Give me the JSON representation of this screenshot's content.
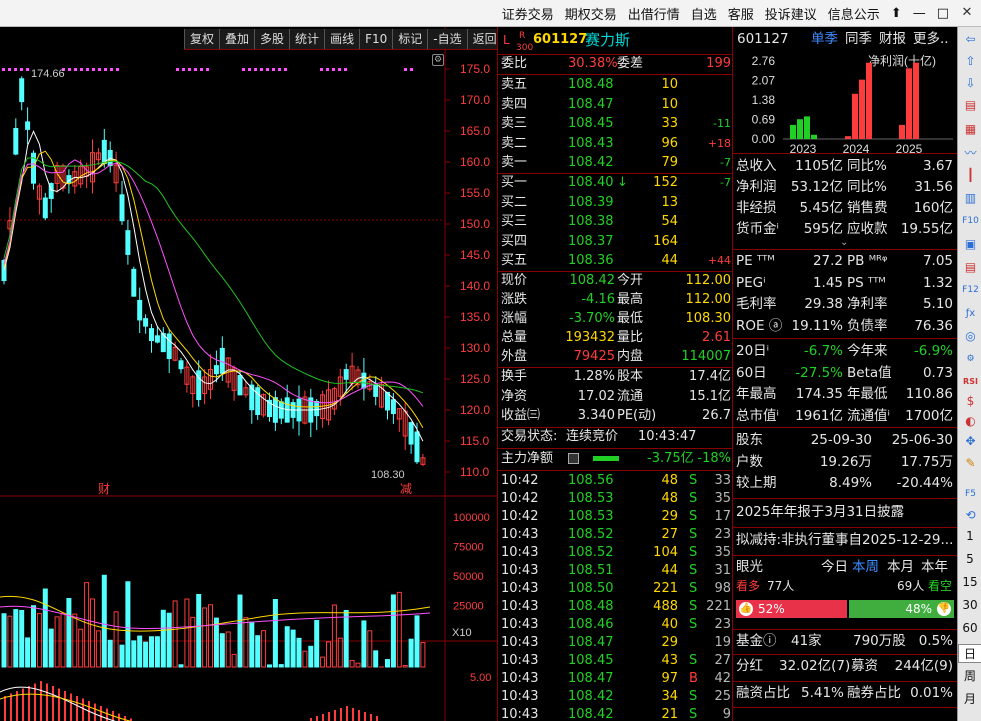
{
  "menu": [
    "证券交易",
    "期权交易",
    "出借行情",
    "自选",
    "客服",
    "投诉建议",
    "信息公示"
  ],
  "window_buttons": {
    "pin": "pin-icon",
    "min": "—",
    "max": "□",
    "close": "✕"
  },
  "chart_toolbar": [
    "复权",
    "叠加",
    "多股",
    "统计",
    "画线",
    "F10",
    "标记",
    "-自选",
    "返回"
  ],
  "price_axis": [
    "175.0",
    "170.0",
    "165.0",
    "160.0",
    "155.0",
    "150.0",
    "145.0",
    "140.0",
    "135.0",
    "130.0",
    "125.0",
    "120.0",
    "115.0",
    "110.0"
  ],
  "high_label": "174.66",
  "low_label": "108.30",
  "markers": {
    "cai": "财",
    "jian": "减"
  },
  "volume_axis": [
    "100000",
    "75000",
    "50000",
    "25000"
  ],
  "volume_unit": "X10",
  "macd_axis": [
    "5.00"
  ],
  "stock": {
    "prefix": "L",
    "tag": "R",
    "index": "300",
    "code": "601127",
    "name": "赛力斯"
  },
  "weibi": {
    "label1": "委比",
    "v1": "30.38%",
    "label2": "委差",
    "v2": "199"
  },
  "asks": [
    {
      "label": "卖五",
      "price": "108.48",
      "vol": "10",
      "chg": ""
    },
    {
      "label": "卖四",
      "price": "108.47",
      "vol": "10",
      "chg": ""
    },
    {
      "label": "卖三",
      "price": "108.45",
      "vol": "33",
      "chg": "-11"
    },
    {
      "label": "卖二",
      "price": "108.43",
      "vol": "96",
      "chg": "+18"
    },
    {
      "label": "卖一",
      "price": "108.42",
      "vol": "79",
      "chg": "-7"
    }
  ],
  "bids": [
    {
      "label": "买一",
      "price": "108.40",
      "vol": "152",
      "chg": "-7",
      "arrow": "↓"
    },
    {
      "label": "买二",
      "price": "108.39",
      "vol": "13",
      "chg": ""
    },
    {
      "label": "买三",
      "price": "108.38",
      "vol": "54",
      "chg": ""
    },
    {
      "label": "买四",
      "price": "108.37",
      "vol": "164",
      "chg": ""
    },
    {
      "label": "买五",
      "price": "108.36",
      "vol": "44",
      "chg": "+44"
    }
  ],
  "stats": [
    {
      "l1": "现价",
      "v1": "108.42",
      "c1": "grn",
      "l2": "今开",
      "v2": "112.00",
      "c2": "yel"
    },
    {
      "l1": "涨跌",
      "v1": "-4.16",
      "c1": "grn",
      "l2": "最高",
      "v2": "112.00",
      "c2": "yel"
    },
    {
      "l1": "涨幅",
      "v1": "-3.70%",
      "c1": "grn",
      "l2": "最低",
      "v2": "108.30",
      "c2": "yel"
    },
    {
      "l1": "总量",
      "v1": "193432",
      "c1": "yel",
      "l2": "量比",
      "v2": "2.61",
      "c2": "red"
    },
    {
      "l1": "外盘",
      "v1": "79425",
      "c1": "red",
      "l2": "内盘",
      "v2": "114007",
      "c2": "grn"
    }
  ],
  "stats2": [
    {
      "l1": "换手",
      "v1": "1.28%",
      "l2": "股本",
      "v2": "17.4亿"
    },
    {
      "l1": "净资",
      "v1": "17.02",
      "l2": "流通",
      "v2": "15.1亿"
    },
    {
      "l1": "收益㈢",
      "v1": "3.340",
      "l2": "PE(动)",
      "v2": "26.7"
    }
  ],
  "trade_state": {
    "label": "交易状态:",
    "value": "连续竞价",
    "time": "10:43:47"
  },
  "main_flow": {
    "label": "主力净额",
    "value": "-3.75亿",
    "pct": "-18%"
  },
  "ticks": [
    [
      "10:42",
      "108.56",
      "48",
      "S",
      "33"
    ],
    [
      "10:42",
      "108.53",
      "48",
      "S",
      "35"
    ],
    [
      "10:42",
      "108.53",
      "29",
      "S",
      "17"
    ],
    [
      "10:43",
      "108.52",
      "27",
      "S",
      "23"
    ],
    [
      "10:43",
      "108.52",
      "104",
      "S",
      "35"
    ],
    [
      "10:43",
      "108.51",
      "44",
      "S",
      "31"
    ],
    [
      "10:43",
      "108.50",
      "221",
      "S",
      "98"
    ],
    [
      "10:43",
      "108.48",
      "488",
      "S",
      "221"
    ],
    [
      "10:43",
      "108.46",
      "40",
      "S",
      "23"
    ],
    [
      "10:43",
      "108.47",
      "29",
      "",
      "19"
    ],
    [
      "10:43",
      "108.45",
      "43",
      "S",
      "27"
    ],
    [
      "10:43",
      "108.47",
      "97",
      "B",
      "42"
    ],
    [
      "10:43",
      "108.42",
      "34",
      "S",
      "25"
    ],
    [
      "10:43",
      "108.42",
      "21",
      "S",
      "9"
    ]
  ],
  "info": {
    "code": "601127",
    "tabs": [
      "单季",
      "同季",
      "财报",
      "更多.."
    ],
    "mini_title": "净利润(十亿)",
    "mini_y": [
      "2.76",
      "2.07",
      "1.38",
      "0.69",
      "0.00"
    ],
    "mini_x": [
      "2023",
      "2024",
      "2025"
    ],
    "fin": [
      {
        "l1": "总收入",
        "v1": "1105亿",
        "l2": "同比%",
        "v2": "3.67"
      },
      {
        "l1": "净利润",
        "v1": "53.12亿",
        "l2": "同比%",
        "v2": "31.56"
      },
      {
        "l1": "非经损",
        "v1": "5.45亿",
        "l2": "销售费",
        "v2": "160亿"
      },
      {
        "l1": "货币金ⁱ",
        "v1": "595亿",
        "l2": "应收款",
        "v2": "19.55亿"
      }
    ],
    "val": [
      {
        "l1": "PE ᵀᵀᴹ",
        "v1": "27.2",
        "l2": "PB ᴹᴿᵠ",
        "v2": "7.05"
      },
      {
        "l1": "PEGⁱ",
        "v1": "1.45",
        "l2": "PS ᵀᵀᴹ",
        "v2": "1.32"
      },
      {
        "l1": "毛利率",
        "v1": "29.38",
        "l2": "净利率",
        "v2": "5.10"
      },
      {
        "l1": "ROE ⓐ",
        "v1": "19.11%",
        "l2": "负债率",
        "v2": "76.36"
      }
    ],
    "perf": [
      {
        "l1": "20日ⁱ",
        "v1": "-6.7%",
        "l2": "今年来",
        "v2": "-6.9%",
        "c": "grn"
      },
      {
        "l1": "60日",
        "v1": "-27.5%",
        "l2": "Beta值",
        "v2": "0.73",
        "c": "grn"
      },
      {
        "l1": "年最高",
        "v1": "174.35",
        "l2": "年最低",
        "v2": "110.86",
        "c": "wht"
      },
      {
        "l1": "总市值ⁱ",
        "v1": "1961亿",
        "l2": "流通值ⁱ",
        "v2": "1700亿",
        "c": "wht"
      }
    ],
    "holders": [
      {
        "l": "股东",
        "a": "25-09-30",
        "b": "25-06-30"
      },
      {
        "l": "户数",
        "a": "19.26万",
        "b": "17.75万"
      },
      {
        "l": "较上期",
        "a": "8.49%",
        "b": "-20.44%"
      }
    ],
    "notice1": "2025年年报于3月31日披露",
    "notice2": "拟减持:非执行董事自2025-12-29...",
    "eye": {
      "label": "眼光",
      "t1": "今日",
      "t2": "本周",
      "t3": "本月",
      "t4": "本年",
      "bear": "看多",
      "bear_n": "77人",
      "bull_n": "69人",
      "bull": "看空",
      "p1": "52%",
      "p2": "48%"
    },
    "fund": {
      "l": "基金ⓘ",
      "a": "41家",
      "b": "790万股",
      "c": "0.5%"
    },
    "div": {
      "l": "分红",
      "a": "32.02亿(7)",
      "b": "募资",
      "c": "244亿(9)"
    },
    "margin": {
      "l": "融资占比",
      "a": "5.41%",
      "b": "融券占比",
      "c": "0.01%"
    }
  },
  "sidebar_periods": [
    "1",
    "5",
    "15",
    "30",
    "60",
    "日",
    "周",
    "月"
  ]
}
